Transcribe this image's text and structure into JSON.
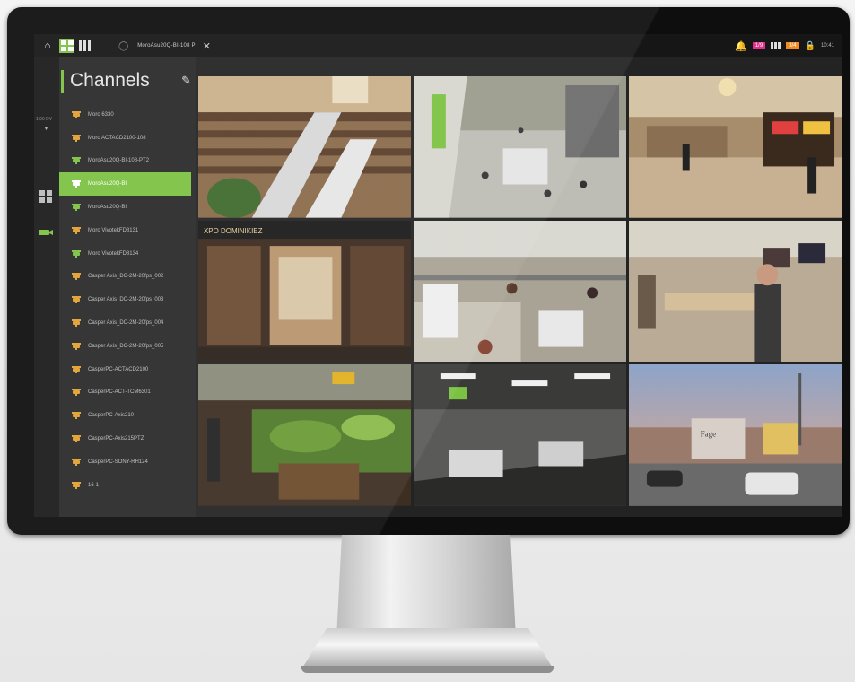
{
  "topbar": {
    "tab_title": "MoroAsu20Q-BI-108 P",
    "alert_badge": "1/9",
    "storage_badge": "3/4",
    "time": "10:41"
  },
  "rail": {
    "time_text": "1:00 DV"
  },
  "panel": {
    "title": "Channels",
    "channels": [
      {
        "label": "Moro 6330",
        "state": "warn"
      },
      {
        "label": "Moro ACTACD2100-108",
        "state": "warn"
      },
      {
        "label": "MoroAsu20Q-BI-108-PT2",
        "state": "ok"
      },
      {
        "label": "MoroAsu20Q-BI",
        "state": "active"
      },
      {
        "label": "MoroAsu20Q-BI",
        "state": "ok"
      },
      {
        "label": "Moro VivotekFD8131",
        "state": "warn"
      },
      {
        "label": "Moro VivotekFD8134",
        "state": "ok"
      },
      {
        "label": "Casper Axis_DC-2M-20fps_002",
        "state": "warn"
      },
      {
        "label": "Casper Axis_DC-2M-20fps_003",
        "state": "warn"
      },
      {
        "label": "Casper Axis_DC-2M-20fps_004",
        "state": "warn"
      },
      {
        "label": "Casper Axis_DC-2M-20fps_005",
        "state": "warn"
      },
      {
        "label": "CasperPC-ACTACD2100",
        "state": "warn"
      },
      {
        "label": "CasperPC-ACT-TCM6301",
        "state": "warn"
      },
      {
        "label": "CasperPC-Axis210",
        "state": "warn"
      },
      {
        "label": "CasperPC-Axis215PTZ",
        "state": "warn"
      },
      {
        "label": "CasperPC-SONY-RH124",
        "state": "warn"
      },
      {
        "label": "16-1",
        "state": "warn"
      }
    ]
  },
  "colors": {
    "accent": "#7cc242",
    "warn_icon": "#e0a030",
    "ok_icon": "#7cc242",
    "alert_badge": "#e0308a",
    "storage_badge": "#f08c22"
  },
  "tiles": [
    {
      "name": "mall-atrium",
      "sign": ""
    },
    {
      "name": "mall-concourse",
      "sign": ""
    },
    {
      "name": "mall-corridor-shops",
      "sign": ""
    },
    {
      "name": "storefront-expo",
      "sign": "XPO DOMINIKIEZ"
    },
    {
      "name": "electronics-store",
      "sign": ""
    },
    {
      "name": "store-customer",
      "sign": ""
    },
    {
      "name": "supermarket-produce",
      "sign": ""
    },
    {
      "name": "checkout-lanes",
      "sign": ""
    },
    {
      "name": "parking-lot",
      "sign": "Fage"
    }
  ]
}
